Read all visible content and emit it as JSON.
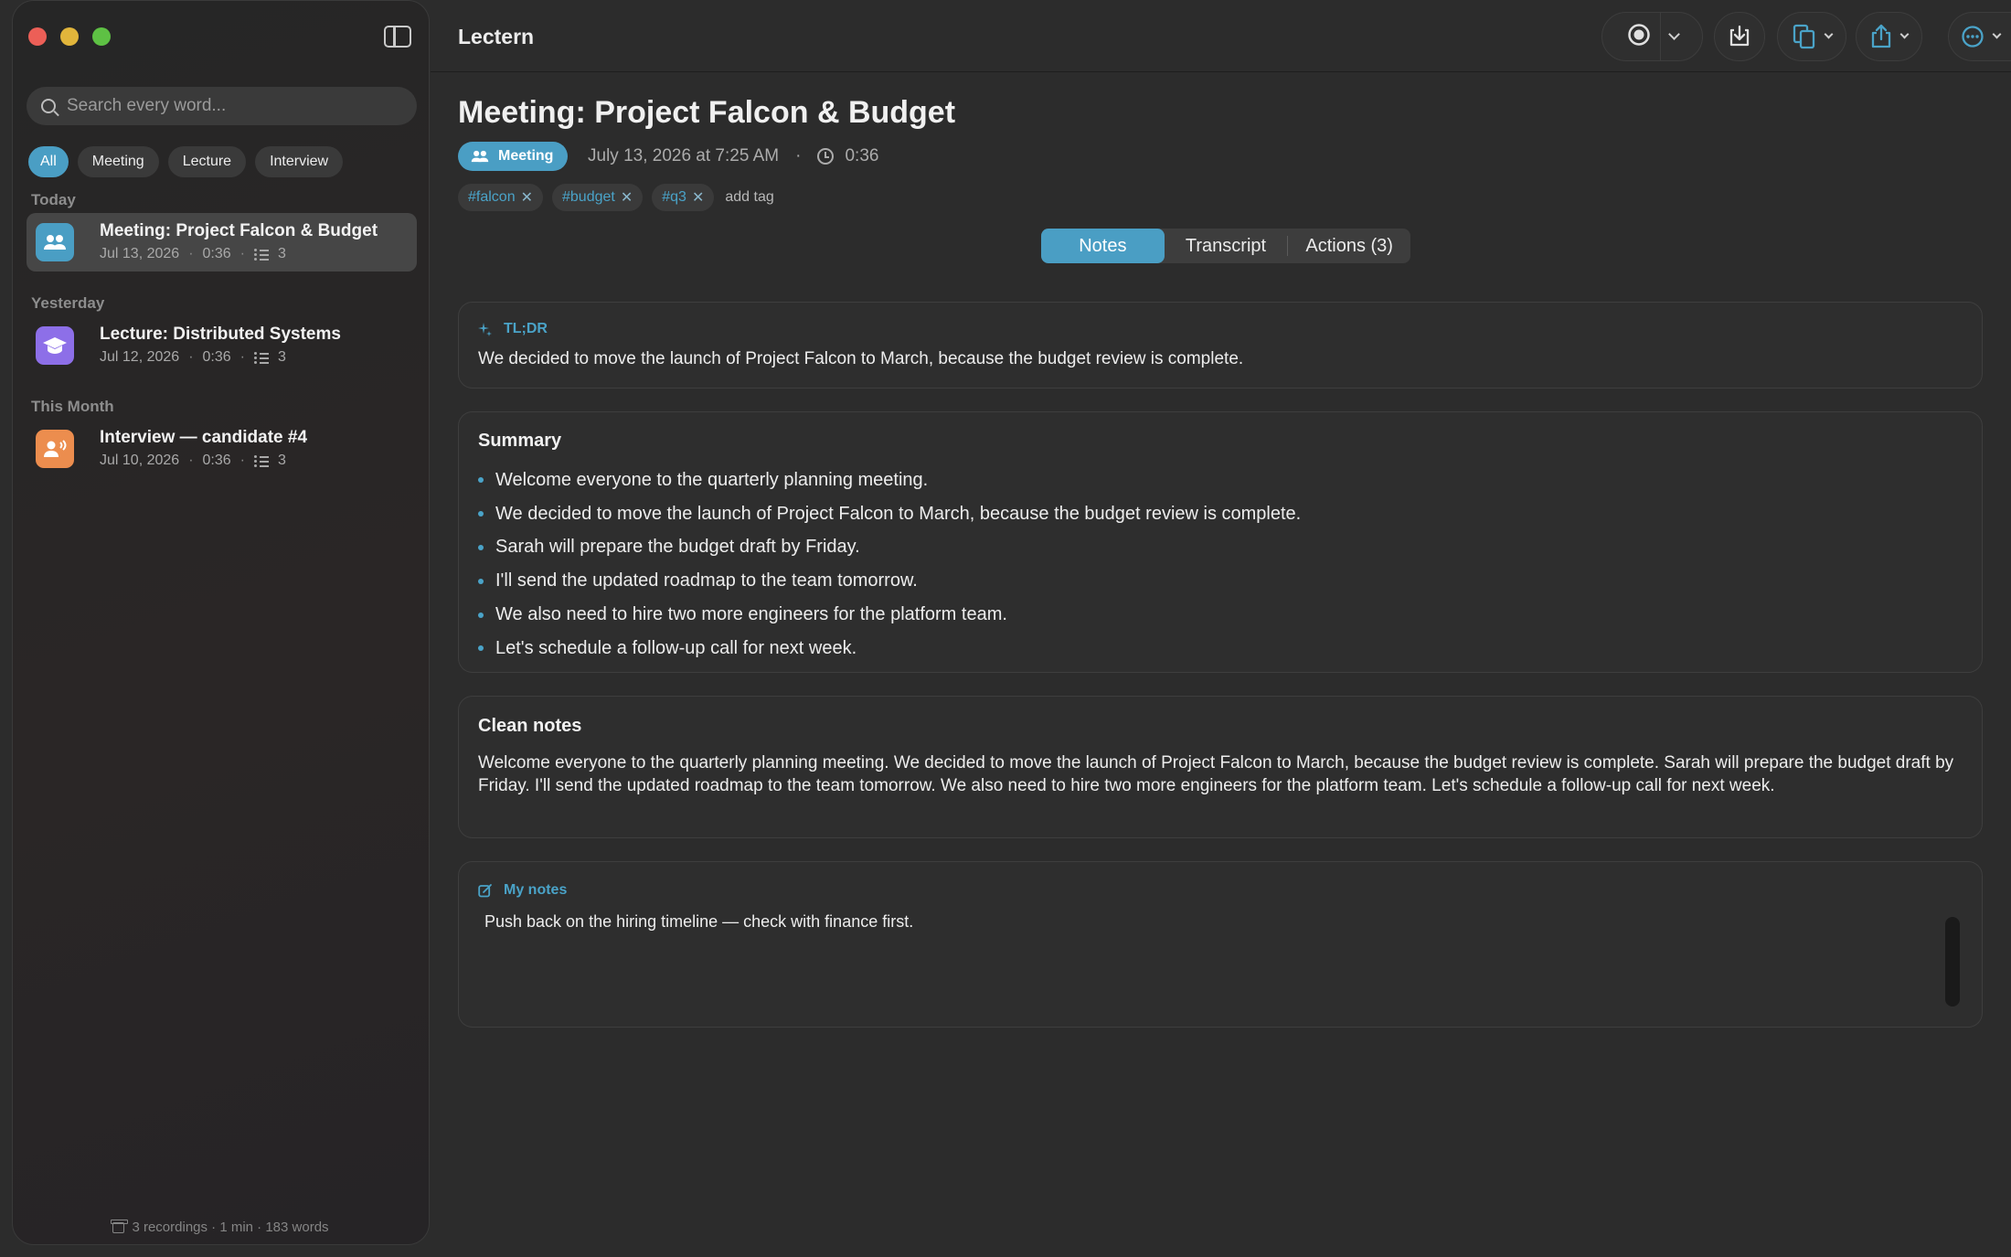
{
  "app": {
    "title": "Lectern"
  },
  "sidebar": {
    "search": {
      "placeholder": "Search every word..."
    },
    "filters": [
      "All",
      "Meeting",
      "Lecture",
      "Interview"
    ],
    "groups": [
      {
        "label": "Today"
      },
      {
        "label": "Yesterday"
      },
      {
        "label": "This Month"
      }
    ],
    "recordings": [
      {
        "title": "Meeting: Project Falcon & Budget",
        "date": "Jul 13, 2026",
        "duration": "0:36",
        "actions": "3",
        "icon": "people-icon",
        "color": "#4a9ec4"
      },
      {
        "title": "Lecture: Distributed Systems",
        "date": "Jul 12, 2026",
        "duration": "0:36",
        "actions": "3",
        "icon": "graduation-cap-icon",
        "color": "#8d6fe8"
      },
      {
        "title": "Interview — candidate #4",
        "date": "Jul 10, 2026",
        "duration": "0:36",
        "actions": "3",
        "icon": "speaking-person-icon",
        "color": "#ec8d4e"
      }
    ],
    "meta_separator": "·",
    "footer": "3 recordings · 1 min · 183 words"
  },
  "document": {
    "title": "Meeting: Project Falcon & Budget",
    "type": "Meeting",
    "datetime": "July 13, 2026 at 7:25 AM",
    "separator": "·",
    "duration": "0:36",
    "tags": [
      "#falcon",
      "#budget",
      "#q3"
    ],
    "tag_remove": "✕",
    "add_tag": "add tag",
    "tabs": [
      "Notes",
      "Transcript",
      "Actions (3)"
    ],
    "tldr": {
      "label": "TL;DR",
      "text": "We decided to move the launch of Project Falcon to March, because the budget review is complete."
    },
    "summary": {
      "heading": "Summary",
      "items": [
        "Welcome everyone to the quarterly planning meeting.",
        "We decided to move the launch of Project Falcon to March, because the budget review is complete.",
        "Sarah will prepare the budget draft by Friday.",
        "I'll send the updated roadmap to the team tomorrow.",
        "We also need to hire two more engineers for the platform team.",
        "Let's schedule a follow-up call for next week."
      ]
    },
    "clean_notes": {
      "heading": "Clean notes",
      "text": "Welcome everyone to the quarterly planning meeting. We decided to move the launch of Project Falcon to March, because the budget review is complete. Sarah will prepare the budget draft by Friday. I'll send the updated roadmap to the team tomorrow. We also need to hire two more engineers for the platform team. Let's schedule a follow-up call for next week."
    },
    "my_notes": {
      "label": "My notes",
      "text": "Push back on the hiring timeline — check with finance first."
    }
  },
  "colors": {
    "accent": "#4a9ec4",
    "background": "#2c2c2c"
  }
}
